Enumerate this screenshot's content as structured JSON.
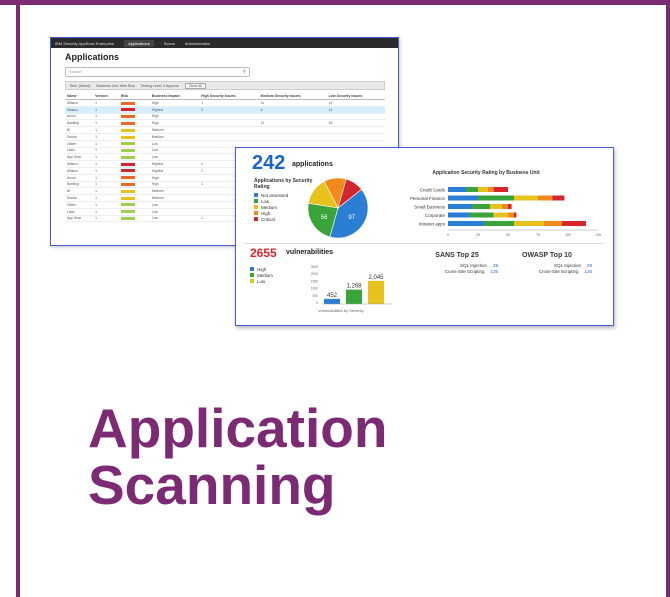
{
  "heading": {
    "line1": "Application",
    "line2": "Scanning"
  },
  "app_window": {
    "nav": [
      "IBM Security AppScan Enterprise",
      "Applications",
      "Scans",
      "Administration"
    ],
    "title": "Applications",
    "search_placeholder": "Search",
    "filters": [
      "Risk: (Mixed)",
      "Business Unit: Web Risk",
      "Testing Level: 3 Approve",
      "Clear All"
    ],
    "columns": [
      "Name",
      "Version",
      "Risk",
      "Business Impact",
      "High Security Issues",
      "Medium Security Issues",
      "Low Security Issues"
    ],
    "rows": [
      [
        "Alfasco",
        "1",
        "",
        "High",
        "1",
        "11",
        "12"
      ],
      [
        "Alfasco",
        "1",
        "",
        "Highest",
        "3",
        "6",
        "14"
      ],
      [
        "Arrow",
        "1",
        "",
        "High",
        "",
        "",
        ""
      ],
      [
        "Banking",
        "1",
        "",
        "High",
        "",
        "11",
        "18"
      ],
      [
        "BI",
        "1",
        "",
        "Medium",
        "",
        "",
        ""
      ],
      [
        "Dentia",
        "1",
        "",
        "Medium",
        "",
        "",
        ""
      ],
      [
        "Glitter",
        "1",
        "",
        "Low",
        "",
        "",
        ""
      ],
      [
        "Lawn",
        "1",
        "",
        "Low",
        "",
        "",
        ""
      ],
      [
        "App Gear",
        "1",
        "",
        "Low",
        "",
        "",
        ""
      ],
      [
        "Alfasco",
        "1",
        "",
        "Highest",
        "2",
        "",
        ""
      ],
      [
        "Alfasco",
        "1",
        "",
        "Highest",
        "2",
        "",
        ""
      ],
      [
        "Arrow",
        "1",
        "",
        "High",
        "",
        "",
        ""
      ],
      [
        "Banking",
        "1",
        "",
        "High",
        "1",
        "",
        ""
      ],
      [
        "BI",
        "1",
        "",
        "Medium",
        "",
        "",
        ""
      ],
      [
        "Dentia",
        "1",
        "",
        "Medium",
        "",
        "",
        ""
      ],
      [
        "Glitter",
        "1",
        "",
        "Low",
        "",
        "",
        ""
      ],
      [
        "Lawn",
        "1",
        "",
        "Low",
        "",
        "",
        ""
      ],
      [
        "App Gear",
        "1",
        "",
        "Low",
        "1",
        "",
        ""
      ]
    ]
  },
  "dashboard": {
    "apps_count": "242",
    "apps_label": "applications",
    "pie_title": "Applications by Security Rating",
    "pie_legend": [
      {
        "label": "Not assessed",
        "color": "#2a7fd4"
      },
      {
        "label": "Low",
        "color": "#3aa33a"
      },
      {
        "label": "Medium",
        "color": "#e8c21c"
      },
      {
        "label": "High",
        "color": "#f08a1c"
      },
      {
        "label": "Critical",
        "color": "#d6262d"
      }
    ],
    "pie_values": [
      40,
      28,
      14,
      10,
      8
    ],
    "pie_labels": [
      "97",
      "56",
      "",
      "",
      ""
    ],
    "bar_title": "Application Security Rating by Business Unit",
    "bar_units": [
      "Credit Cards",
      "Personal Finance",
      "Small Business",
      "Corporate",
      "Intranet apps"
    ],
    "bar_axis": [
      "0",
      "25",
      "50",
      "75",
      "100",
      "125"
    ],
    "vuln_count": "2655",
    "vuln_label": "vulnerabilities",
    "vuln_legend": [
      {
        "label": "High",
        "color": "#2a7fd4"
      },
      {
        "label": "Medium",
        "color": "#3aa33a"
      },
      {
        "label": "Low",
        "color": "#e8c21c"
      }
    ],
    "vuln_caption": "Vulnerabilities by Severity",
    "vuln_axis": [
      "3000",
      "2000",
      "1500",
      "1000",
      "500",
      "0"
    ],
    "sans_title": "SANS Top 25",
    "owasp_title": "OWASP Top 10",
    "top_rows": [
      {
        "label": "SQL Injection",
        "value": "29"
      },
      {
        "label": "Cross-Site Scripting",
        "value": "135"
      }
    ]
  },
  "chart_data": [
    {
      "type": "pie",
      "title": "Applications by Security Rating",
      "categories": [
        "Not assessed",
        "Low",
        "Medium",
        "High",
        "Critical"
      ],
      "values": [
        97,
        56,
        36,
        29,
        24
      ]
    },
    {
      "type": "bar",
      "title": "Application Security Rating by Business Unit",
      "categories": [
        "Credit Cards",
        "Personal Finance",
        "Small Business",
        "Corporate",
        "Intranet apps"
      ],
      "series": [
        {
          "name": "Not assessed",
          "values": [
            15,
            25,
            20,
            18,
            30
          ]
        },
        {
          "name": "Low",
          "values": [
            10,
            30,
            15,
            20,
            25
          ]
        },
        {
          "name": "Medium",
          "values": [
            8,
            20,
            10,
            12,
            25
          ]
        },
        {
          "name": "High",
          "values": [
            5,
            12,
            5,
            5,
            15
          ]
        },
        {
          "name": "Critical",
          "values": [
            12,
            10,
            3,
            2,
            20
          ]
        }
      ],
      "xlim": [
        0,
        125
      ]
    },
    {
      "type": "bar",
      "title": "Vulnerabilities by Severity",
      "categories": [
        "High",
        "Medium",
        "Low"
      ],
      "values": [
        452,
        1268,
        2045
      ],
      "data_labels": [
        "452",
        "1,268",
        "2,045"
      ],
      "ylim": [
        0,
        3000
      ]
    }
  ]
}
